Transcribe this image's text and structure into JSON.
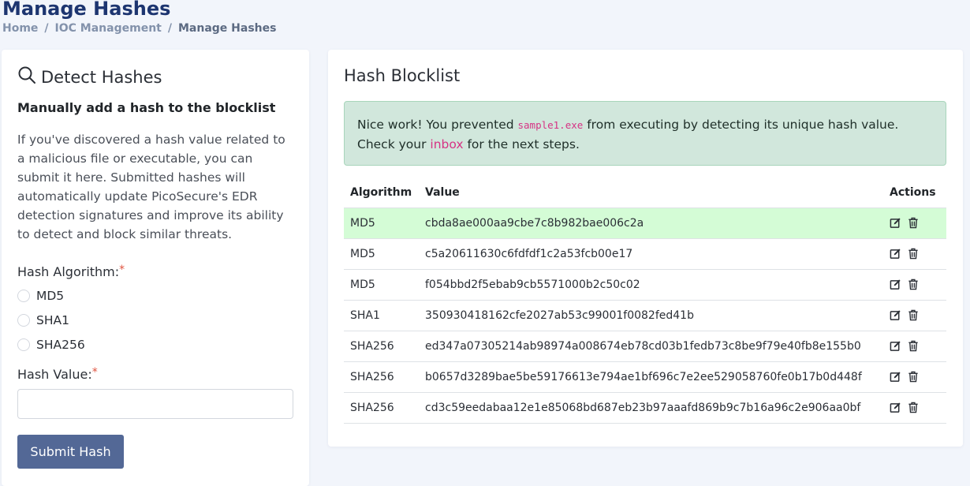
{
  "header": {
    "title": "Manage Hashes",
    "breadcrumb": [
      "Home",
      "IOC Management",
      "Manage Hashes"
    ],
    "separator": "/"
  },
  "left": {
    "title": "Detect Hashes",
    "subheading": "Manually add a hash to the blocklist",
    "description": "If you've discovered a hash value related to a malicious file or executable, you can submit it here. Submitted hashes will automatically update PicoSecure's EDR detection signatures and improve its ability to detect and block similar threats.",
    "algorithm_label": "Hash Algorithm:",
    "required_mark": "*",
    "algorithms": [
      "MD5",
      "SHA1",
      "SHA256"
    ],
    "value_label": "Hash Value:",
    "value_input": "",
    "submit_label": "Submit Hash"
  },
  "right": {
    "title": "Hash Blocklist",
    "alert": {
      "pre": "Nice work! You prevented ",
      "code": "sample1.exe",
      "mid": " from executing by detecting its unique hash value. Check your ",
      "link": "inbox",
      "post": " for the next steps."
    },
    "columns": [
      "Algorithm",
      "Value",
      "Actions"
    ],
    "rows": [
      {
        "algorithm": "MD5",
        "value": "cbda8ae000aa9cbe7c8b982bae006c2a",
        "highlighted": true
      },
      {
        "algorithm": "MD5",
        "value": "c5a20611630c6fdfdf1c2a53fcb00e17",
        "highlighted": false
      },
      {
        "algorithm": "MD5",
        "value": "f054bbd2f5ebab9cb5571000b2c50c02",
        "highlighted": false
      },
      {
        "algorithm": "SHA1",
        "value": "350930418162cfe2027ab53c99001f0082fed41b",
        "highlighted": false
      },
      {
        "algorithm": "SHA256",
        "value": "ed347a07305214ab98974a008674eb78cd03b1fedb73c8be9f79e40fb8e155b0",
        "highlighted": false
      },
      {
        "algorithm": "SHA256",
        "value": "b0657d3289bae5be59176613e794ae1bf696c7e2ee529058760fe0b17b0d448f",
        "highlighted": false
      },
      {
        "algorithm": "SHA256",
        "value": "cd3c59eedabaa12e1e85068bd687eb23b97aaafd869b9c7b16a96c2e906aa0bf",
        "highlighted": false
      }
    ],
    "row_actions": [
      "edit-icon",
      "trash-icon"
    ]
  },
  "colors": {
    "title": "#1d3570",
    "button": "#536896",
    "alert_bg": "#d1e7dc",
    "highlight_row": "#d4fcd6",
    "accent_pink": "#d63384",
    "required": "#e0533f"
  }
}
